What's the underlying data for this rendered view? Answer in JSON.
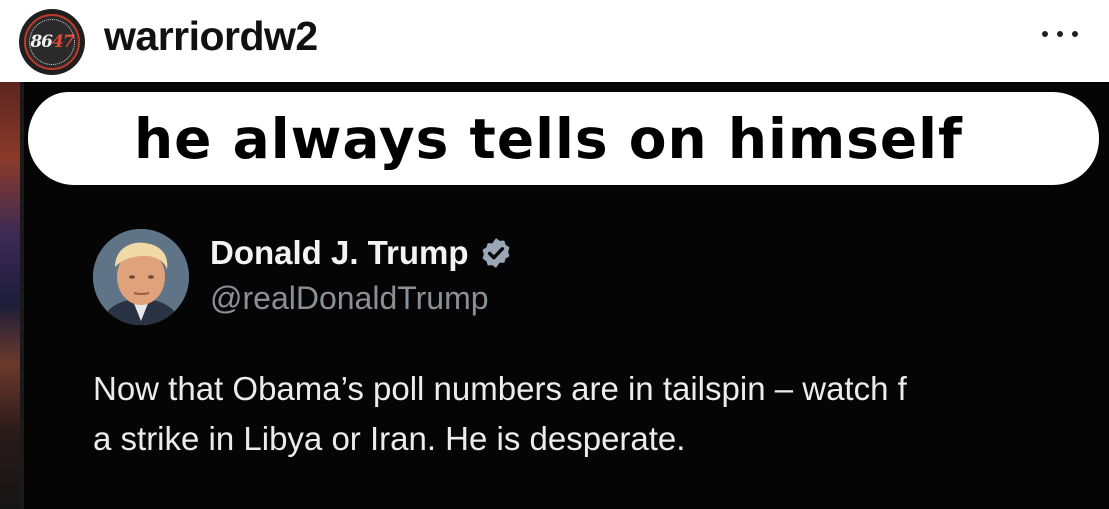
{
  "post": {
    "username": "warriordw2",
    "avatar": {
      "text_main": "86",
      "text_sub": "47",
      "accent": "#e2453a"
    },
    "more_icon": "more-horizontal-icon"
  },
  "media": {
    "caption": "he always tells on himself",
    "tweet": {
      "name": "Donald J. Trump",
      "handle": "@realDonaldTrump",
      "verified_color": "#9aa7b7",
      "line1": "Now that Obama’s poll numbers are in tailspin – watch f",
      "line2": "a strike in Libya or Iran.  He is desperate."
    }
  }
}
